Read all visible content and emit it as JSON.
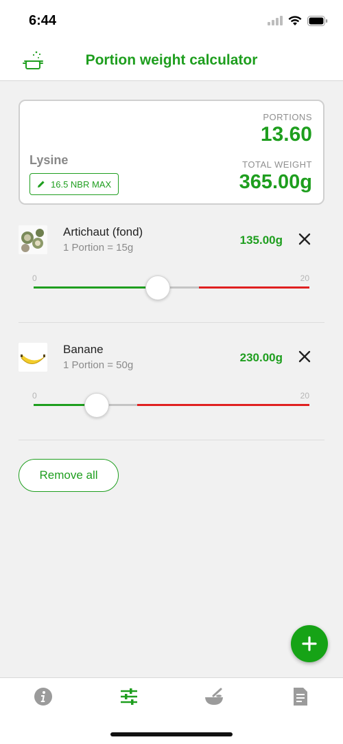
{
  "status_bar": {
    "time": "6:44"
  },
  "header": {
    "title": "Portion weight calculator",
    "logo_icon": "cooking-pot-icon"
  },
  "summary": {
    "nutrient_name": "Lysine",
    "limit_label": "16.5 NBR MAX",
    "portions_label": "PORTIONS",
    "portions_value": "13.60",
    "total_weight_label": "TOTAL WEIGHT",
    "total_weight_value": "365.00g"
  },
  "items": [
    {
      "name": "Artichaut (fond)",
      "portion": "1 Portion = 15g",
      "weight": "135.00g",
      "slider": {
        "min_label": "0",
        "max_label": "20",
        "min": 0,
        "max": 20,
        "value": 9,
        "limit": 12
      }
    },
    {
      "name": "Banane",
      "portion": "1 Portion = 50g",
      "weight": "230.00g",
      "slider": {
        "min_label": "0",
        "max_label": "20",
        "min": 0,
        "max": 20,
        "value": 4.6,
        "limit": 7.5
      }
    }
  ],
  "actions": {
    "remove_all_label": "Remove all"
  },
  "tabbar": {
    "tabs": [
      {
        "icon": "info-icon",
        "active": false
      },
      {
        "icon": "sliders-icon",
        "active": true
      },
      {
        "icon": "mixing-bowl-icon",
        "active": false
      },
      {
        "icon": "document-icon",
        "active": false
      }
    ]
  },
  "colors": {
    "accent": "#1e9e1e",
    "limit_red": "#e02020",
    "inactive_gray": "#9b9b9b"
  }
}
